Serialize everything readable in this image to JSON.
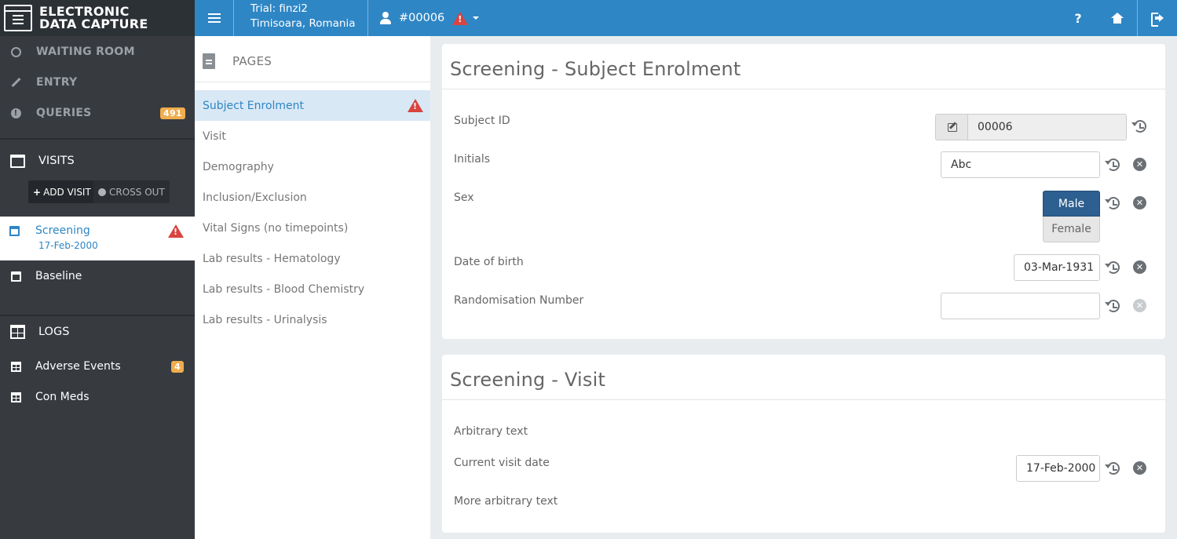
{
  "app": {
    "brand_line1": "ELECTRONIC",
    "brand_line2": "DATA CAPTURE"
  },
  "header": {
    "trial_line1": "Trial: finzi2",
    "trial_line2": "Timisoara, Romania",
    "subject": "#00006",
    "help_label": "?"
  },
  "sidebar": {
    "waiting_room": "WAITING ROOM",
    "entry": "ENTRY",
    "queries": "QUERIES",
    "queries_count": "491",
    "visits_title": "VISITS",
    "add_visit": "ADD VISIT",
    "cross_out": "CROSS OUT",
    "visits": [
      {
        "label": "Screening",
        "date": "17-Feb-2000"
      },
      {
        "label": "Baseline"
      }
    ],
    "logs_title": "LOGS",
    "logs": [
      {
        "label": "Adverse Events",
        "count": "4"
      },
      {
        "label": "Con Meds"
      }
    ]
  },
  "pages": {
    "title": "PAGES",
    "items": [
      "Subject Enrolment",
      "Visit",
      "Demography",
      "Inclusion/Exclusion",
      "Vital Signs (no timepoints)",
      "Lab results - Hematology",
      "Lab results - Blood Chemistry",
      "Lab results - Urinalysis"
    ]
  },
  "enrolment": {
    "title": "Screening - Subject Enrolment",
    "subject_id_label": "Subject ID",
    "subject_id_value": "00006",
    "initials_label": "Initials",
    "initials_value": "Abc",
    "sex_label": "Sex",
    "sex_options": [
      "Male",
      "Female"
    ],
    "sex_selected": "Male",
    "dob_label": "Date of birth",
    "dob_value": "03-Mar-1931",
    "rand_label": "Randomisation Number",
    "rand_value": ""
  },
  "visit": {
    "title": "Screening - Visit",
    "arbitrary_text": "Arbitrary text",
    "visit_date_label": "Current visit date",
    "visit_date_value": "17-Feb-2000",
    "more_text": "More arbitrary text"
  },
  "colors": {
    "topbar": "#2e86c5",
    "sidebar": "#373b40",
    "warning": "#d9443f",
    "badge": "#f0ad4e",
    "selected": "#2d5f90"
  }
}
